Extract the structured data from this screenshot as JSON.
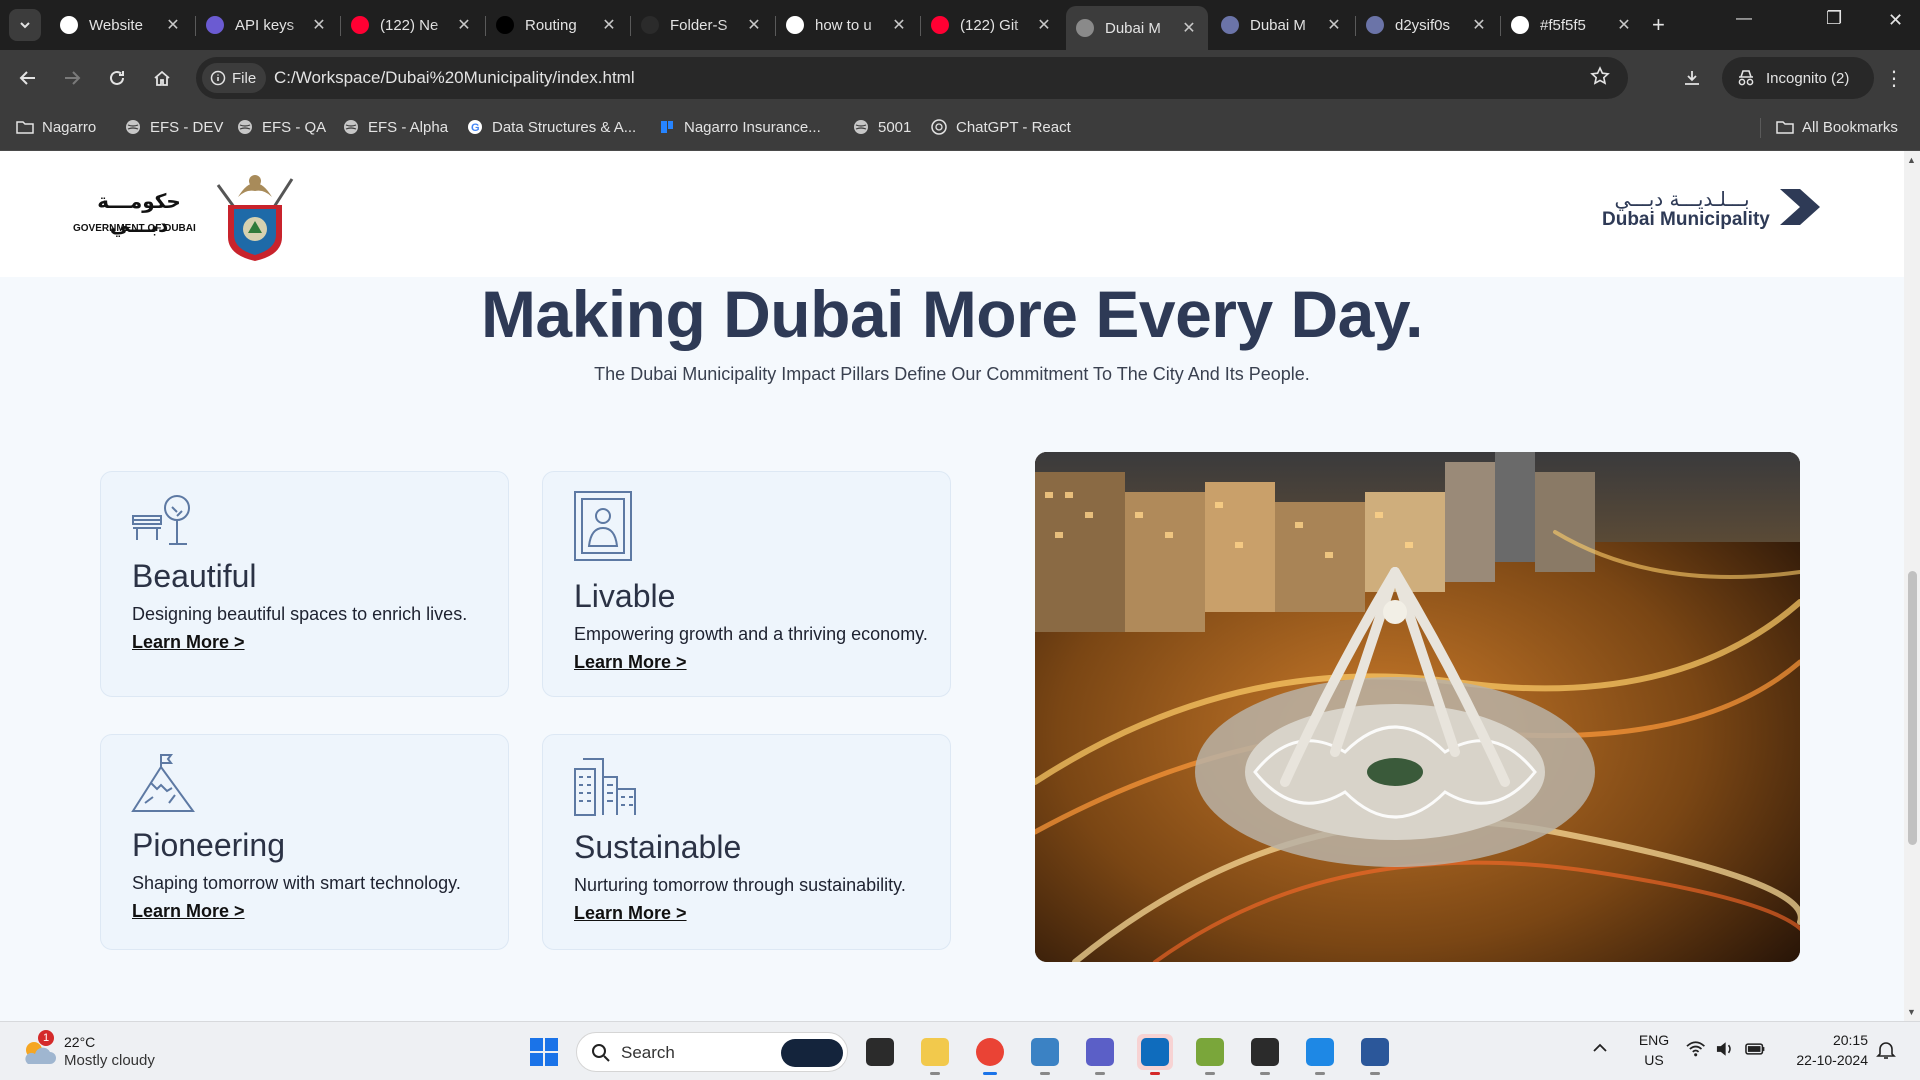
{
  "tabs": [
    {
      "title": "Website",
      "icon": "chatgpt-icon",
      "color": "#ffffff"
    },
    {
      "title": "API keys",
      "icon": "openai-icon",
      "color": "#6b5bd2"
    },
    {
      "title": "(122) Ne",
      "icon": "youtube-icon",
      "color": "#ff0033"
    },
    {
      "title": "Routing",
      "icon": "nextjs-icon",
      "color": "#000000"
    },
    {
      "title": "Folder-S",
      "icon": "github-icon",
      "color": "#2b2b2b"
    },
    {
      "title": "how to u",
      "icon": "google-icon",
      "color": "#ffffff"
    },
    {
      "title": "(122) Git",
      "icon": "youtube-icon",
      "color": "#ff0033"
    },
    {
      "title": "Dubai M",
      "icon": "globe-icon",
      "color": "#8a8a8a"
    },
    {
      "title": "Dubai M",
      "icon": "dm-logo-icon",
      "color": "#6b74a8"
    },
    {
      "title": "d2ysif0s",
      "icon": "dm-logo-icon",
      "color": "#6b74a8"
    },
    {
      "title": "#f5f5f5",
      "icon": "google-icon",
      "color": "#ffffff"
    }
  ],
  "active_tab_index": 7,
  "toolbar": {
    "site_chip": "File",
    "url": "C:/Workspace/Dubai%20Municipality/index.html",
    "incognito_label": "Incognito (2)"
  },
  "bookmarks": [
    {
      "label": "Nagarro",
      "icon": "folder-icon"
    },
    {
      "label": "EFS - DEV",
      "icon": "globe-icon"
    },
    {
      "label": "EFS - QA",
      "icon": "globe-icon"
    },
    {
      "label": "EFS - Alpha",
      "icon": "globe-icon"
    },
    {
      "label": "Data Structures & A...",
      "icon": "google-icon"
    },
    {
      "label": "Nagarro Insurance...",
      "icon": "jira-icon"
    },
    {
      "label": "5001",
      "icon": "globe-icon"
    },
    {
      "label": "ChatGPT - React",
      "icon": "chatgpt-icon"
    }
  ],
  "all_bookmarks": "All Bookmarks",
  "header": {
    "gov_arabic": "حكومـــة دبـــي",
    "gov_english": "GOVERNMENT OF DUBAI",
    "dm_arabic": "بـــلـديـــة دبـــي",
    "dm_english": "Dubai Municipality"
  },
  "hero": {
    "title": "Making Dubai More Every Day.",
    "subtitle": "The Dubai Municipality Impact Pillars Define Our Commitment To The City And Its People."
  },
  "pillars": [
    {
      "title": "Beautiful",
      "description": "Designing beautiful spaces to enrich lives.",
      "link": "Learn More >",
      "icon": "park-bench-tree-icon"
    },
    {
      "title": "Livable",
      "description": "Empowering growth and a thriving economy.",
      "link": "Learn More >",
      "icon": "person-frame-icon"
    },
    {
      "title": "Pioneering",
      "description": "Shaping tomorrow with smart technology.",
      "link": "Learn More >",
      "icon": "mountain-flag-icon"
    },
    {
      "title": "Sustainable",
      "description": "Nurturing tomorrow through sustainability.",
      "link": "Learn More >",
      "icon": "city-buildings-icon"
    }
  ],
  "taskbar": {
    "weather_temp": "22°C",
    "weather_desc": "Mostly cloudy",
    "weather_badge": "1",
    "search_placeholder": "Search",
    "lang_top": "ENG",
    "lang_bottom": "US",
    "time": "20:15",
    "date": "22-10-2024"
  }
}
